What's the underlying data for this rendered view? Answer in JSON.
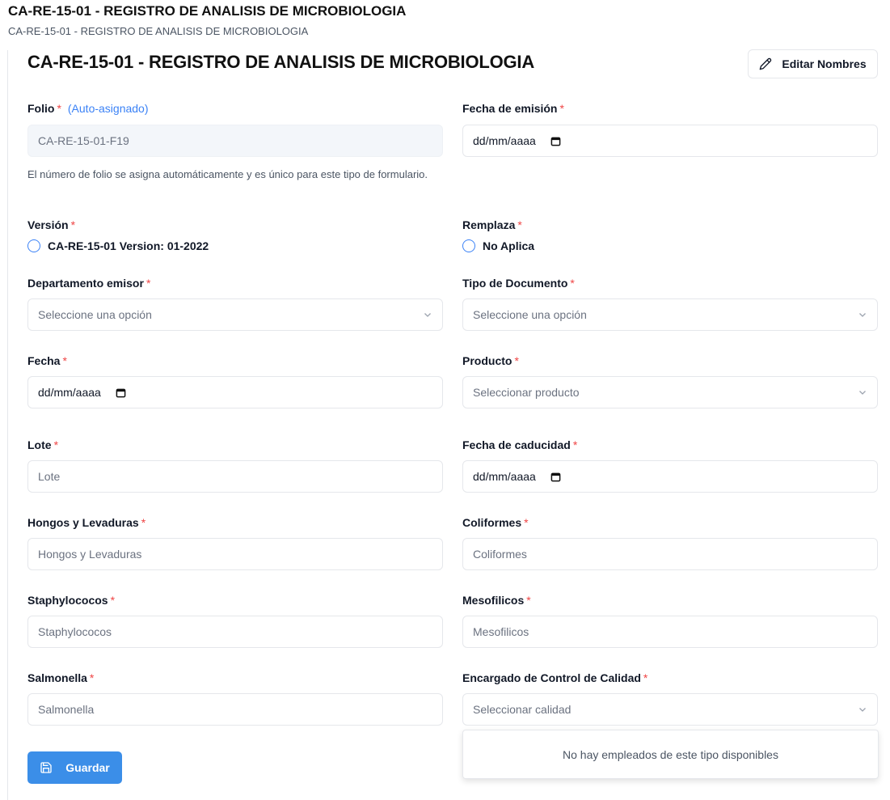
{
  "page": {
    "heading": "CA-RE-15-01 - REGISTRO DE ANALISIS DE MICROBIOLOGIA",
    "subheading": "CA-RE-15-01 - REGISTRO DE ANALISIS DE MICROBIOLOGIA"
  },
  "form": {
    "title": "CA-RE-15-01 - REGISTRO DE ANALISIS DE MICROBIOLOGIA",
    "edit_names_label": "Editar Nombres",
    "required_mark": "*",
    "folio": {
      "label": "Folio",
      "auto_label": "(Auto-asignado)",
      "value": "CA-RE-15-01-F19",
      "help": "El número de folio se asigna automáticamente y es único para este tipo de formulario."
    },
    "fecha_emision": {
      "label": "Fecha de emisión",
      "value": "dd/mm/aaaa"
    },
    "version": {
      "label": "Versión",
      "option": "CA-RE-15-01 Version: 01-2022"
    },
    "remplaza": {
      "label": "Remplaza",
      "option": "No Aplica"
    },
    "departamento": {
      "label": "Departamento emisor",
      "placeholder": "Seleccione una opción"
    },
    "tipo_documento": {
      "label": "Tipo de Documento",
      "placeholder": "Seleccione una opción"
    },
    "fecha": {
      "label": "Fecha",
      "value": "dd/mm/aaaa"
    },
    "producto": {
      "label": "Producto",
      "placeholder": "Seleccionar producto"
    },
    "lote": {
      "label": "Lote",
      "placeholder": "Lote"
    },
    "fecha_caducidad": {
      "label": "Fecha de caducidad",
      "value": "dd/mm/aaaa"
    },
    "hongos": {
      "label": "Hongos y Levaduras",
      "placeholder": "Hongos y Levaduras"
    },
    "coliformes": {
      "label": "Coliformes",
      "placeholder": "Coliformes"
    },
    "staphylococos": {
      "label": "Staphylococos",
      "placeholder": "Staphylococos"
    },
    "mesofilicos": {
      "label": "Mesofilicos",
      "placeholder": "Mesofilicos"
    },
    "salmonella": {
      "label": "Salmonella",
      "placeholder": "Salmonella"
    },
    "encargado": {
      "label": "Encargado de Control de Calidad",
      "placeholder": "Seleccionar calidad",
      "empty_message": "No hay empleados de este tipo disponibles"
    },
    "save_label": "Guardar"
  },
  "colors": {
    "primary": "#3b8ee8",
    "required": "#ef4444",
    "link": "#3b82f6"
  },
  "icons": {
    "edit": "pencil-icon",
    "save": "floppy-disk-icon",
    "calendar": "calendar-icon",
    "chevron": "chevron-down-icon"
  }
}
